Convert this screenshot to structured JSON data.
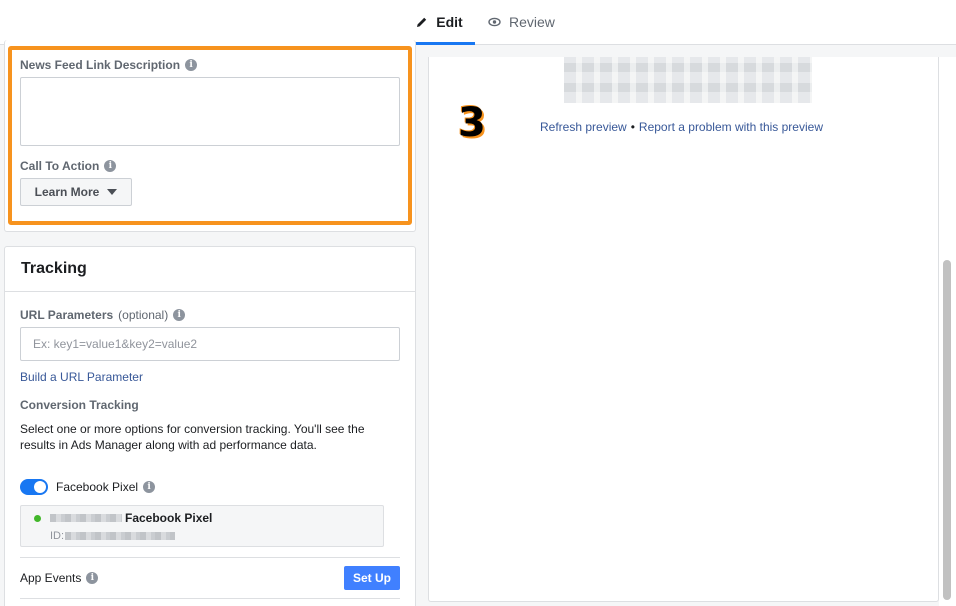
{
  "tabs": {
    "edit_label": "Edit",
    "review_label": "Review"
  },
  "creative": {
    "news_feed_link_description_label": "News Feed Link Description",
    "news_feed_link_description_value": "",
    "call_to_action_label": "Call To Action",
    "call_to_action_value": "Learn More"
  },
  "annotation": {
    "step_number": "3",
    "highlight_color": "#f7931e"
  },
  "preview": {
    "refresh_link": "Refresh preview",
    "separator": "•",
    "report_link": "Report a problem with this preview"
  },
  "tracking": {
    "title": "Tracking",
    "url_parameters_label": "URL Parameters",
    "url_parameters_optional": "(optional)",
    "url_parameters_placeholder": "Ex: key1=value1&key2=value2",
    "build_url_link": "Build a URL Parameter",
    "conversion_tracking_label": "Conversion Tracking",
    "conversion_tracking_description": "Select one or more options for conversion tracking. You'll see the results in Ads Manager along with ad performance data.",
    "facebook_pixel_label": "Facebook Pixel",
    "facebook_pixel_enabled": true,
    "pixel_name": "Facebook Pixel",
    "pixel_id_label": "ID:",
    "pixel_status_color": "#42b72a",
    "app_events_label": "App Events",
    "setup_button": "Set Up"
  },
  "colors": {
    "accent": "#1877f2",
    "button": "#4080ff",
    "link": "#385898"
  }
}
